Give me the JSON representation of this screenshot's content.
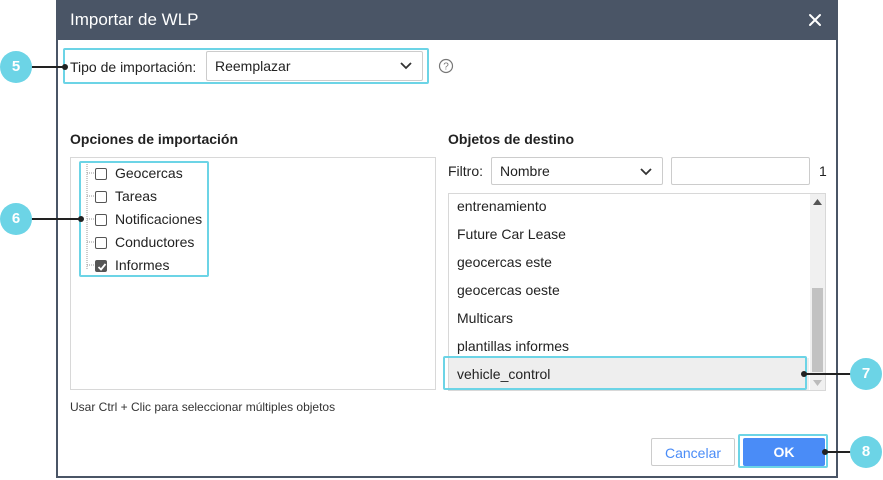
{
  "dialog": {
    "title": "Importar de WLP",
    "close_icon": "close-icon"
  },
  "import_type": {
    "label": "Tipo de importación:",
    "value": "Reemplazar",
    "help_icon": "question-circle-icon"
  },
  "options": {
    "heading": "Opciones de importación",
    "items": [
      {
        "label": "Geocercas",
        "checked": false
      },
      {
        "label": "Tareas",
        "checked": false
      },
      {
        "label": "Notificaciones",
        "checked": false
      },
      {
        "label": "Conductores",
        "checked": false
      },
      {
        "label": "Informes",
        "checked": true
      }
    ],
    "hint": "Usar Ctrl + Clic para seleccionar múltiples objetos"
  },
  "targets": {
    "heading": "Objetos de destino",
    "filter_label": "Filtro:",
    "filter_value": "Nombre",
    "search_value": "",
    "count": "1",
    "items": [
      {
        "label": "entrenamiento"
      },
      {
        "label": "Future Car Lease"
      },
      {
        "label": "geocercas este"
      },
      {
        "label": "geocercas oeste"
      },
      {
        "label": "Multicars"
      },
      {
        "label": "plantillas informes"
      },
      {
        "label": "vehicle_control",
        "selected": true
      }
    ]
  },
  "buttons": {
    "cancel": "Cancelar",
    "ok": "OK"
  },
  "callouts": [
    "5",
    "6",
    "7",
    "8"
  ],
  "colors": {
    "titlebar": "#4a5566",
    "callout": "#6cd4e6",
    "ok_button": "#4a8cf7"
  }
}
